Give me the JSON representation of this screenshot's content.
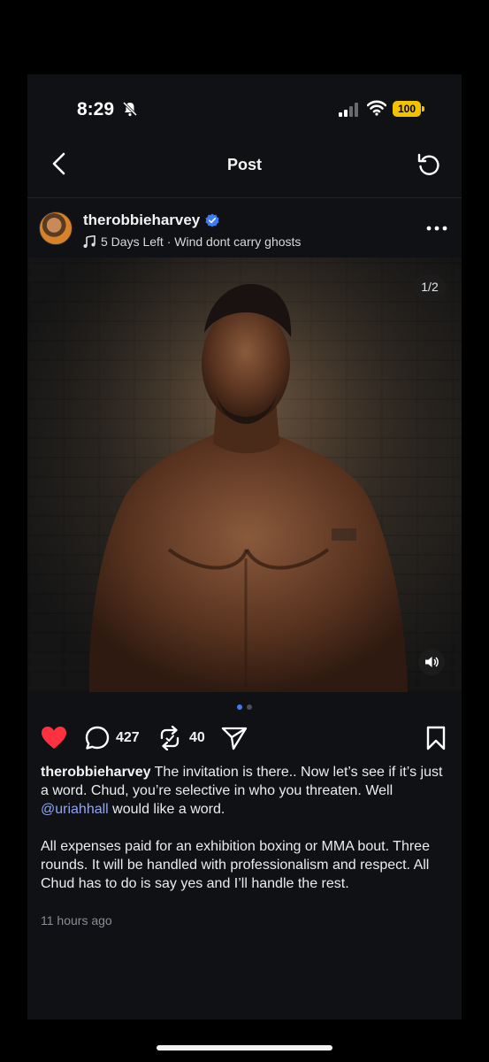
{
  "status_bar": {
    "time": "8:29",
    "battery": "100",
    "colors": {
      "battery": "#f2c200"
    }
  },
  "nav": {
    "title": "Post"
  },
  "post": {
    "username": "therobbieharvey",
    "music": "5 Days Left · Wind dont carry ghosts",
    "image_counter": "1/2",
    "comment_count": "427",
    "repost_count": "40",
    "caption": {
      "username": "therobbieharvey",
      "text_1": " The invitation is there.. Now let’s see if it’s just a word. Chud, you’re selective in who you threaten. Well ",
      "mention": "@uriahhall",
      "text_2": " would like a word.",
      "paragraph_2": "All expenses paid for an exhibition boxing or MMA bout. Three rounds. It will be handled with professionalism and respect. All Chud has to do is say yes and I’ll handle the rest."
    },
    "timestamp": "11 hours ago",
    "liked": true,
    "colors": {
      "like": "#ff3040",
      "link": "#8ea6f6",
      "verified": "#3d7bf7",
      "active_dot": "#3d7bf7"
    }
  },
  "icons": {
    "bell": "bell-slash-icon",
    "signal": "cellular-signal-icon",
    "wifi": "wifi-icon",
    "back": "chevron-left-icon",
    "refresh": "refresh-icon",
    "verified": "verified-badge-icon",
    "music": "music-note-icon",
    "more": "more-horizontal-icon",
    "like": "heart-icon",
    "comment": "comment-icon",
    "repost": "repost-icon",
    "share": "send-icon",
    "save": "bookmark-icon",
    "sound": "speaker-icon"
  }
}
